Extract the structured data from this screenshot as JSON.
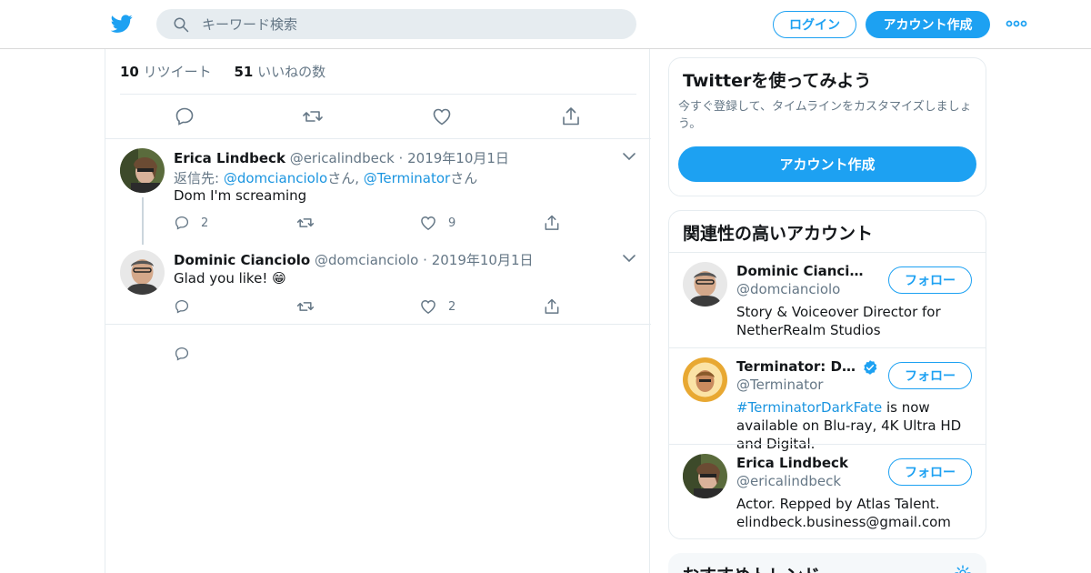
{
  "header": {
    "search_placeholder": "キーワード検索",
    "login_label": "ログイン",
    "signup_label": "アカウント作成"
  },
  "tweet_stats": {
    "retweets_count": "10",
    "retweets_label": "リツイート",
    "likes_count": "51",
    "likes_label": "いいねの数"
  },
  "replies": [
    {
      "name": "Erica Lindbeck",
      "handle": "@ericalindbeck",
      "date": "2019年10月1日",
      "reply_prefix": "返信先: ",
      "reply_user1": "@domcianciolo",
      "reply_suffix1": "さん, ",
      "reply_user2": "@Terminator",
      "reply_suffix2": "さん",
      "text": "Dom I'm screaming",
      "reply_count": "2",
      "like_count": "9"
    },
    {
      "name": "Dominic Cianciolo",
      "handle": "@domcianciolo",
      "date": "2019年10月1日",
      "text": "Glad you like! 😁",
      "like_count": "2"
    }
  ],
  "signup_card": {
    "title": "Twitterを使ってみよう",
    "description": "今すぐ登録して、タイムラインをカスタマイズしましょう。",
    "button_label": "アカウント作成"
  },
  "related_card": {
    "title": "関連性の高いアカウント",
    "follow_label": "フォロー",
    "accounts": [
      {
        "name": "Dominic Cianciolo",
        "handle": "@domcianciolo",
        "bio": "Story & Voiceover Director for NetherRealm Studios"
      },
      {
        "name": "Terminator: Dark…",
        "handle": "@Terminator",
        "bio_link": "#TerminatorDarkFate",
        "bio": " is now available on Blu-ray, 4K Ultra HD and Digital."
      },
      {
        "name": "Erica Lindbeck",
        "handle": "@ericalindbeck",
        "bio": "Actor. Repped by Atlas Talent. elindbeck.business@gmail.com"
      }
    ]
  },
  "trends_card": {
    "title": "おすすめトレンド"
  },
  "colors": {
    "brand_blue": "#1da1f2",
    "link_blue": "#1b95e0",
    "muted_gray": "#657786"
  }
}
